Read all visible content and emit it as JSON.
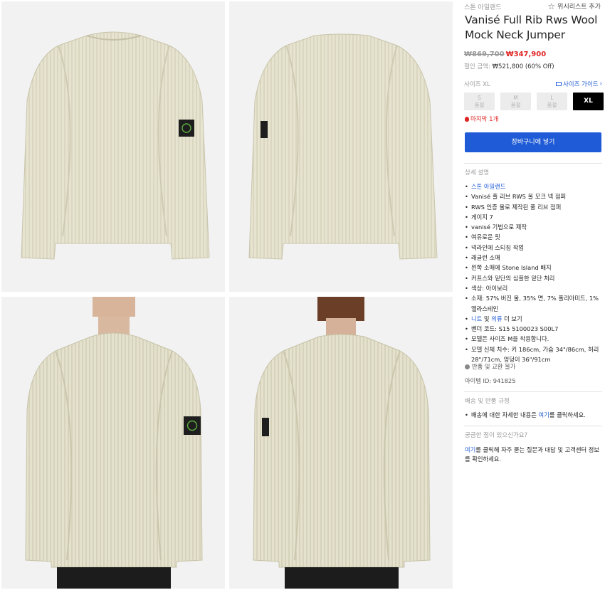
{
  "gallery": {
    "images": [
      {
        "name": "product-front-image",
        "alt": "front"
      },
      {
        "name": "product-back-image",
        "alt": "back"
      },
      {
        "name": "model-front-image",
        "alt": "model front"
      },
      {
        "name": "model-back-image",
        "alt": "model back"
      }
    ],
    "colors": {
      "sweater": "#e6e3d0",
      "rib": "#cfcbb3",
      "background": "#f2f2f2",
      "badge": "#1e1e1e",
      "badge_logo": "#5fae3f",
      "pants": "#1c1c1c"
    }
  },
  "header": {
    "brand": "스톤 아일랜드",
    "wishlist_label": "위시리스트 추가",
    "wishlist_icon": "star-outline-icon"
  },
  "product": {
    "title": "Vanisé Full Rib Rws Wool Mock Neck Jumper",
    "original_price": "₩869,700",
    "sale_price": "₩347,900",
    "discount_label": "절인 금액:",
    "discount_value": "₩521,800 (60% Off)"
  },
  "size": {
    "label": "사이즈 XL",
    "guide_label": "사이즈 가이드",
    "guide_icon": "ruler-icon",
    "options": [
      {
        "size": "S",
        "status": "품절"
      },
      {
        "size": "M",
        "status": "품절"
      },
      {
        "size": "L",
        "status": "품절"
      },
      {
        "size": "XL",
        "status": ""
      }
    ],
    "selected": "XL"
  },
  "stock": {
    "label": "마지막 1개",
    "icon": "fire-icon"
  },
  "cart_button": "장바구니에 넣기",
  "details": {
    "title": "상세 설명",
    "brand_link": "스톤 아일랜드",
    "items": [
      "Vanisé 풀 리브 RWS 울 모크 넥 점퍼",
      "RWS 인증 울로 제작된 풀 리브 점퍼",
      "게이지 7",
      "vanisé 기법으로 제작",
      "여유로운 핏",
      "넥라인에 스티칭 작업",
      "래글런 소매",
      "왼쪽 소매에 Stone Island 배지",
      "커프스와 밑단의 심플한 밑단 처리",
      "색상: 아이보리",
      "소재: 57% 버진 울, 35% 면, 7% 폴리아미드, 1% 엘라스테인"
    ],
    "knit_link": "니트",
    "and_text": "및",
    "clothing_link": "의류",
    "more_text": "더 보기",
    "items_after": [
      "벤더 코드: S15 5100023 S00L7",
      "모델은 사이즈 M을 착용합니다.",
      "모델 신체 치수: 키 186cm, 가슴 34\"/86cm, 허리 28\"/71cm, 엉덩이 36\"/91cm"
    ],
    "return_label": "반품 및 교환 불가",
    "item_id": "아이템 ID: 941825"
  },
  "shipping": {
    "title": "배송 및 반품 규정",
    "text_before": "배송에 대한 자세한 내용은",
    "link": "여기",
    "text_after": "를 클릭하세요."
  },
  "help": {
    "title": "궁금한 점이 있으신가요?",
    "link": "여기",
    "text": "를 클릭해 자주 묻는 질문과 대답 및 고객센터 정보를 확인하세요."
  }
}
